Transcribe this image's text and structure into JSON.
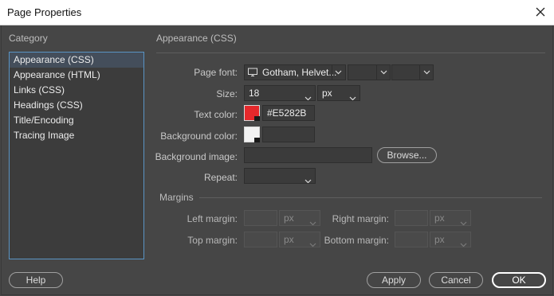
{
  "window": {
    "title": "Page Properties"
  },
  "category": {
    "label": "Category",
    "items": [
      "Appearance (CSS)",
      "Appearance (HTML)",
      "Links (CSS)",
      "Headings (CSS)",
      "Title/Encoding",
      "Tracing Image"
    ],
    "selected_index": 0
  },
  "section": {
    "title": "Appearance (CSS)"
  },
  "page_font": {
    "label": "Page font:",
    "value": "Gotham, Helvet...",
    "style_value": "",
    "weight_value": ""
  },
  "size": {
    "label": "Size:",
    "value": "18",
    "unit": "px"
  },
  "text_color": {
    "label": "Text color:",
    "value": "#E5282B",
    "swatch": "#e5282b"
  },
  "background_color": {
    "label": "Background color:",
    "value": "",
    "swatch": "#f2f2f2"
  },
  "background_image": {
    "label": "Background image:",
    "value": "",
    "browse_label": "Browse..."
  },
  "repeat": {
    "label": "Repeat:",
    "value": ""
  },
  "margins": {
    "label": "Margins",
    "left": {
      "label": "Left margin:",
      "value": "",
      "unit": "px"
    },
    "right": {
      "label": "Right margin:",
      "value": "",
      "unit": "px"
    },
    "top": {
      "label": "Top margin:",
      "value": "",
      "unit": "px"
    },
    "bottom": {
      "label": "Bottom margin:",
      "value": "",
      "unit": "px"
    }
  },
  "buttons": {
    "help": "Help",
    "apply": "Apply",
    "cancel": "Cancel",
    "ok": "OK"
  }
}
